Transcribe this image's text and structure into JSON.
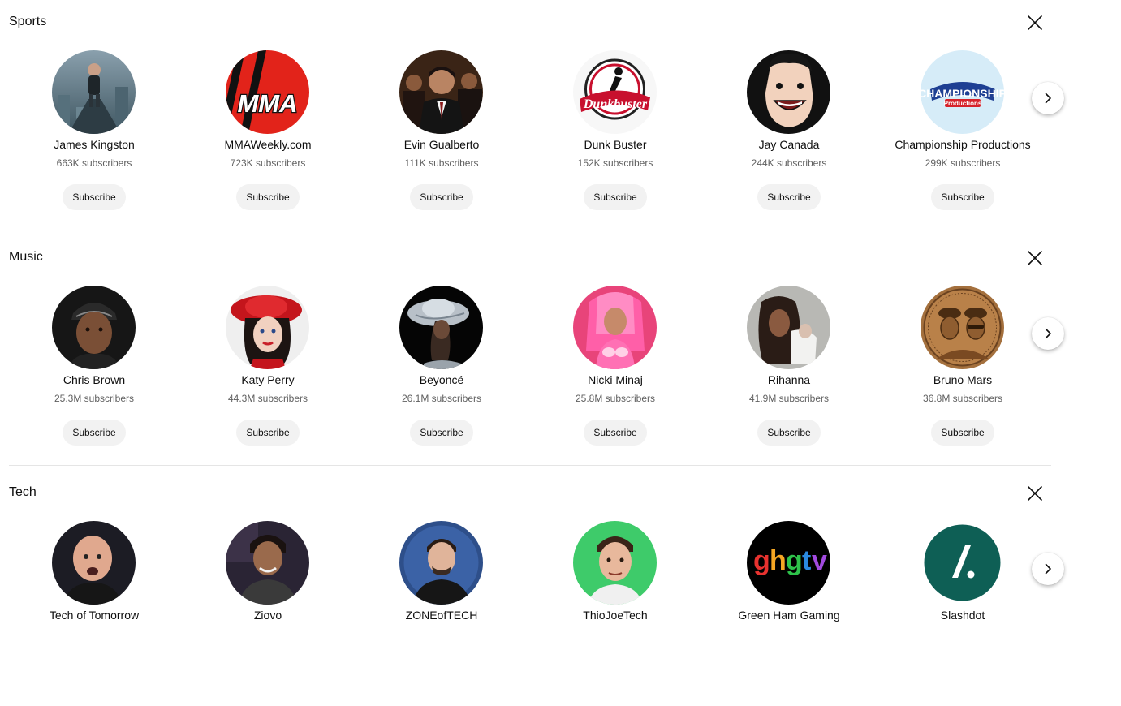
{
  "colors": {
    "text_primary": "#0f0f0f",
    "text_secondary": "#606060",
    "button_bg": "#f2f2f2",
    "divider": "#e5e5e5"
  },
  "icons": {
    "close": "close-icon",
    "next": "chevron-right-icon"
  },
  "shelves": [
    {
      "title": "Sports",
      "channels": [
        {
          "name": "James Kingston",
          "subscribers": "663K subscribers",
          "button": "Subscribe",
          "avatar": "rooftop-photo"
        },
        {
          "name": "MMAWeekly.com",
          "subscribers": "723K subscribers",
          "button": "Subscribe",
          "avatar": "mma-logo"
        },
        {
          "name": "Evin Gualberto",
          "subscribers": "111K subscribers",
          "button": "Subscribe",
          "avatar": "man-in-suit-photo"
        },
        {
          "name": "Dunk Buster",
          "subscribers": "152K subscribers",
          "button": "Subscribe",
          "avatar": "dunkbuster-logo"
        },
        {
          "name": "Jay Canada",
          "subscribers": "244K subscribers",
          "button": "Subscribe",
          "avatar": "smiling-face-cartoon"
        },
        {
          "name": "Championship Productions",
          "subscribers": "299K subscribers",
          "button": "Subscribe",
          "avatar": "championship-logo"
        }
      ]
    },
    {
      "title": "Music",
      "channels": [
        {
          "name": "Chris Brown",
          "subscribers": "25.3M subscribers",
          "button": "Subscribe",
          "avatar": "portrait-photo"
        },
        {
          "name": "Katy Perry",
          "subscribers": "44.3M subscribers",
          "button": "Subscribe",
          "avatar": "portrait-photo"
        },
        {
          "name": "Beyoncé",
          "subscribers": "26.1M subscribers",
          "button": "Subscribe",
          "avatar": "portrait-photo"
        },
        {
          "name": "Nicki Minaj",
          "subscribers": "25.8M subscribers",
          "button": "Subscribe",
          "avatar": "portrait-photo"
        },
        {
          "name": "Rihanna",
          "subscribers": "41.9M subscribers",
          "button": "Subscribe",
          "avatar": "portrait-photo"
        },
        {
          "name": "Bruno Mars",
          "subscribers": "36.8M subscribers",
          "button": "Subscribe",
          "avatar": "engraved-coin-art"
        }
      ]
    },
    {
      "title": "Tech",
      "channels": [
        {
          "name": "Tech of Tomorrow",
          "subscribers": "",
          "button": "Subscribe",
          "avatar": "portrait-photo"
        },
        {
          "name": "Ziovo",
          "subscribers": "",
          "button": "Subscribe",
          "avatar": "portrait-photo"
        },
        {
          "name": "ZONEofTECH",
          "subscribers": "",
          "button": "Subscribe",
          "avatar": "portrait-photo"
        },
        {
          "name": "ThioJoeTech",
          "subscribers": "",
          "button": "Subscribe",
          "avatar": "portrait-photo"
        },
        {
          "name": "Green Ham Gaming",
          "subscribers": "",
          "button": "Subscribe",
          "avatar": "ghgtv-logo"
        },
        {
          "name": "Slashdot",
          "subscribers": "",
          "button": "Subscribe",
          "avatar": "slashdot-logo"
        }
      ]
    }
  ]
}
